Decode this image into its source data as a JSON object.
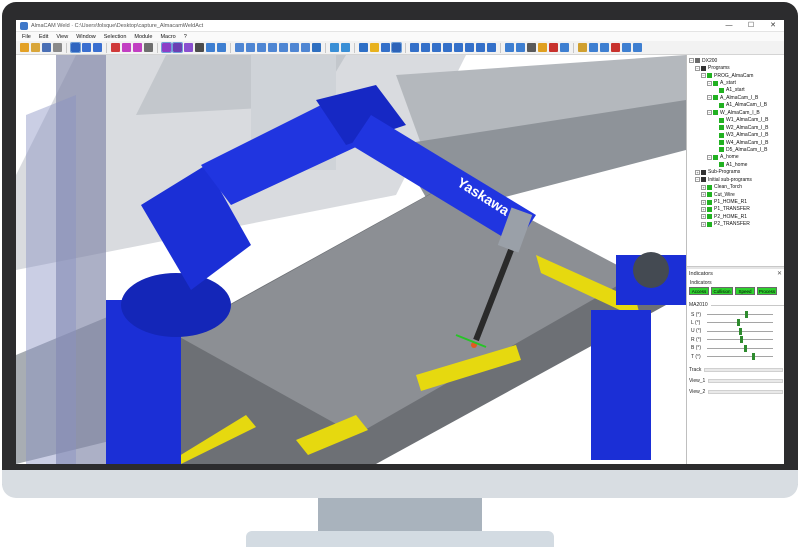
{
  "window": {
    "title": "AlmaCAM Weld · C:\\Users\\folsque\\Desktop\\capture_AlmacamWeldAct",
    "minimize_glyph": "—",
    "maximize_glyph": "☐",
    "close_glyph": "✕"
  },
  "menu": [
    "File",
    "Edit",
    "View",
    "Window",
    "Selection",
    "Module",
    "Macro",
    "?"
  ],
  "toolbar": {
    "buttons": [
      {
        "icon": "new-file-icon",
        "color": "#e3a126"
      },
      {
        "icon": "open-folder-icon",
        "color": "#d9a63a"
      },
      {
        "icon": "save-icon",
        "color": "#4a6fb5"
      },
      {
        "icon": "print-icon",
        "color": "#8a8a8a"
      },
      {
        "sep": true
      },
      {
        "icon": "pointer-icon",
        "color": "#2f65c0",
        "selected": true
      },
      {
        "icon": "undo-icon",
        "color": "#3a6fd0"
      },
      {
        "icon": "redo-icon",
        "color": "#3a6fd0"
      },
      {
        "sep": true
      },
      {
        "icon": "cut-icon",
        "color": "#d03a3a"
      },
      {
        "icon": "rotate-icon",
        "color": "#c23fc2"
      },
      {
        "icon": "move-icon",
        "color": "#c23fc2"
      },
      {
        "icon": "sweep-icon",
        "color": "#6e6e6e"
      },
      {
        "sep": true
      },
      {
        "icon": "select-solid-icon",
        "color": "#8c3fc7",
        "selected": true
      },
      {
        "icon": "select-face-icon",
        "color": "#6b3fb3",
        "selected": true
      },
      {
        "icon": "fit-icon",
        "color": "#8a4fd0"
      },
      {
        "icon": "pan-icon",
        "color": "#4b4b4b"
      },
      {
        "icon": "zoom-in-icon",
        "color": "#3e7fd1"
      },
      {
        "icon": "zoom-out-icon",
        "color": "#3e7fd1"
      },
      {
        "sep": true
      },
      {
        "icon": "view-front-icon",
        "color": "#4f86d3"
      },
      {
        "icon": "view-back-icon",
        "color": "#4f86d3"
      },
      {
        "icon": "view-left-icon",
        "color": "#4f86d3"
      },
      {
        "icon": "view-right-icon",
        "color": "#4f86d3"
      },
      {
        "icon": "view-top-icon",
        "color": "#4f86d3"
      },
      {
        "icon": "view-bottom-icon",
        "color": "#4f86d3"
      },
      {
        "icon": "view-iso-icon",
        "color": "#4f86d3"
      },
      {
        "icon": "wireframe-icon",
        "color": "#2f6fc0"
      },
      {
        "sep": true
      },
      {
        "icon": "simulate-icon",
        "color": "#3a8fd6"
      },
      {
        "icon": "target-icon",
        "color": "#3a8fd6"
      },
      {
        "sep": true
      },
      {
        "icon": "welding-torch-icon",
        "color": "#2e6fc6"
      },
      {
        "icon": "bulb-icon",
        "color": "#e8b21f"
      },
      {
        "icon": "robot-icon",
        "color": "#3470c9"
      },
      {
        "icon": "grid-icon",
        "color": "#2d63b8",
        "selected": true
      },
      {
        "sep": true
      },
      {
        "icon": "align-icon",
        "color": "#3470c9"
      },
      {
        "icon": "tool-frame-icon",
        "color": "#3470c9"
      },
      {
        "icon": "reach-icon",
        "color": "#3470c9"
      },
      {
        "icon": "path-icon",
        "color": "#3470c9"
      },
      {
        "icon": "measure-icon",
        "color": "#3470c9"
      },
      {
        "icon": "collision-icon",
        "color": "#3470c9"
      },
      {
        "icon": "trace-icon",
        "color": "#3470c9"
      },
      {
        "icon": "calibrate-icon",
        "color": "#3470c9"
      },
      {
        "sep": true
      },
      {
        "icon": "step-back-icon",
        "color": "#3e7fd1"
      },
      {
        "icon": "step-forward-icon",
        "color": "#3e7fd1"
      },
      {
        "icon": "program-icon",
        "color": "#5a5a5a"
      },
      {
        "icon": "warning-icon",
        "color": "#e0a020"
      },
      {
        "icon": "stop-icon",
        "color": "#c8322d"
      },
      {
        "icon": "config-icon",
        "color": "#3e7fd1"
      },
      {
        "sep": true
      },
      {
        "icon": "export-icon",
        "color": "#d0a030"
      },
      {
        "icon": "post-processor-icon",
        "color": "#3e7fd1"
      },
      {
        "icon": "settings-icon",
        "color": "#3e7fd1"
      },
      {
        "icon": "delete-icon",
        "color": "#c8322d"
      },
      {
        "icon": "report-icon",
        "color": "#3e7fd1"
      },
      {
        "icon": "help-icon",
        "color": "#3e7fd1"
      }
    ]
  },
  "viewport": {
    "robot_brand": "Yaskawa",
    "robot_color": "#1b2fd6",
    "fixture_color": "#e6d90f",
    "part_color": "#8a8a8a",
    "frame_color": "#9a9ea4"
  },
  "tree": {
    "items": [
      {
        "label": "DX200",
        "level": 0,
        "expander": "-",
        "icon": "controller-icon",
        "icon_color": "#6a6a6a"
      },
      {
        "label": "Programs",
        "level": 1,
        "expander": "-",
        "icon": "folder-icon",
        "icon_color": "#333333"
      },
      {
        "label": "PROG_AlmaCam",
        "level": 2,
        "expander": "-",
        "icon": "program-icon",
        "icon_color": "#21b121"
      },
      {
        "label": "A_start",
        "level": 3,
        "expander": "-",
        "icon": "program-icon",
        "icon_color": "#21b121"
      },
      {
        "label": "A1_start",
        "level": 4,
        "expander": "",
        "icon": "point-icon",
        "icon_color": "#21b121"
      },
      {
        "label": "A_AlmaCam_I_B",
        "level": 3,
        "expander": "-",
        "icon": "program-icon",
        "icon_color": "#21b121"
      },
      {
        "label": "A1_AlmaCam_I_B",
        "level": 4,
        "expander": "",
        "icon": "point-icon",
        "icon_color": "#21b121"
      },
      {
        "label": "W_AlmaCam_I_B",
        "level": 3,
        "expander": "-",
        "icon": "program-icon",
        "icon_color": "#21b121"
      },
      {
        "label": "W1_AlmaCam_I_B",
        "level": 4,
        "expander": "",
        "icon": "point-icon",
        "icon_color": "#21b121"
      },
      {
        "label": "W2_AlmaCam_I_B",
        "level": 4,
        "expander": "",
        "icon": "point-icon",
        "icon_color": "#21b121"
      },
      {
        "label": "W3_AlmaCam_I_B",
        "level": 4,
        "expander": "",
        "icon": "point-icon",
        "icon_color": "#21b121"
      },
      {
        "label": "W4_AlmaCam_I_B",
        "level": 4,
        "expander": "",
        "icon": "point-icon",
        "icon_color": "#21b121"
      },
      {
        "label": "D5_AlmaCam_I_B",
        "level": 4,
        "expander": "",
        "icon": "point-icon",
        "icon_color": "#21b121"
      },
      {
        "label": "A_home",
        "level": 3,
        "expander": "-",
        "icon": "program-icon",
        "icon_color": "#21b121"
      },
      {
        "label": "A1_home",
        "level": 4,
        "expander": "",
        "icon": "point-icon",
        "icon_color": "#21b121"
      },
      {
        "label": "Sub-Programs",
        "level": 1,
        "expander": "+",
        "icon": "folder-icon",
        "icon_color": "#333333"
      },
      {
        "label": "Initial sub-programs",
        "level": 1,
        "expander": "-",
        "icon": "folder-icon",
        "icon_color": "#333333"
      },
      {
        "label": "Clean_Torch",
        "level": 2,
        "expander": "+",
        "icon": "program-icon",
        "icon_color": "#21b121"
      },
      {
        "label": "Cut_Wire",
        "level": 2,
        "expander": "+",
        "icon": "program-icon",
        "icon_color": "#21b121"
      },
      {
        "label": "P1_HOME_R1",
        "level": 2,
        "expander": "+",
        "icon": "program-icon",
        "icon_color": "#21b121"
      },
      {
        "label": "P1_TRANSFER",
        "level": 2,
        "expander": "+",
        "icon": "program-icon",
        "icon_color": "#21b121"
      },
      {
        "label": "P2_HOME_R1",
        "level": 2,
        "expander": "+",
        "icon": "program-icon",
        "icon_color": "#21b121"
      },
      {
        "label": "P2_TRANSFER",
        "level": 2,
        "expander": "+",
        "icon": "program-icon",
        "icon_color": "#21b121"
      }
    ]
  },
  "indicators": {
    "title": "Indicators",
    "close_glyph": "✕",
    "subtitle": "Indicators",
    "status": [
      {
        "label": "Access",
        "color": "#2ed12e"
      },
      {
        "label": "Collision",
        "color": "#2ed12e"
      },
      {
        "label": "Speed",
        "color": "#2ed12e"
      },
      {
        "label": "Process",
        "color": "#2ed12e"
      }
    ],
    "robot_group": "MA2010",
    "axes": [
      {
        "label": "S (°)",
        "value": 0.6
      },
      {
        "label": "L (°)",
        "value": 0.48
      },
      {
        "label": "U (°)",
        "value": 0.5
      },
      {
        "label": "R (°)",
        "value": 0.52
      },
      {
        "label": "B (°)",
        "value": 0.58
      },
      {
        "label": "T (°)",
        "value": 0.7
      }
    ],
    "collapsed": [
      "Track",
      "View_1",
      "View_2"
    ]
  }
}
